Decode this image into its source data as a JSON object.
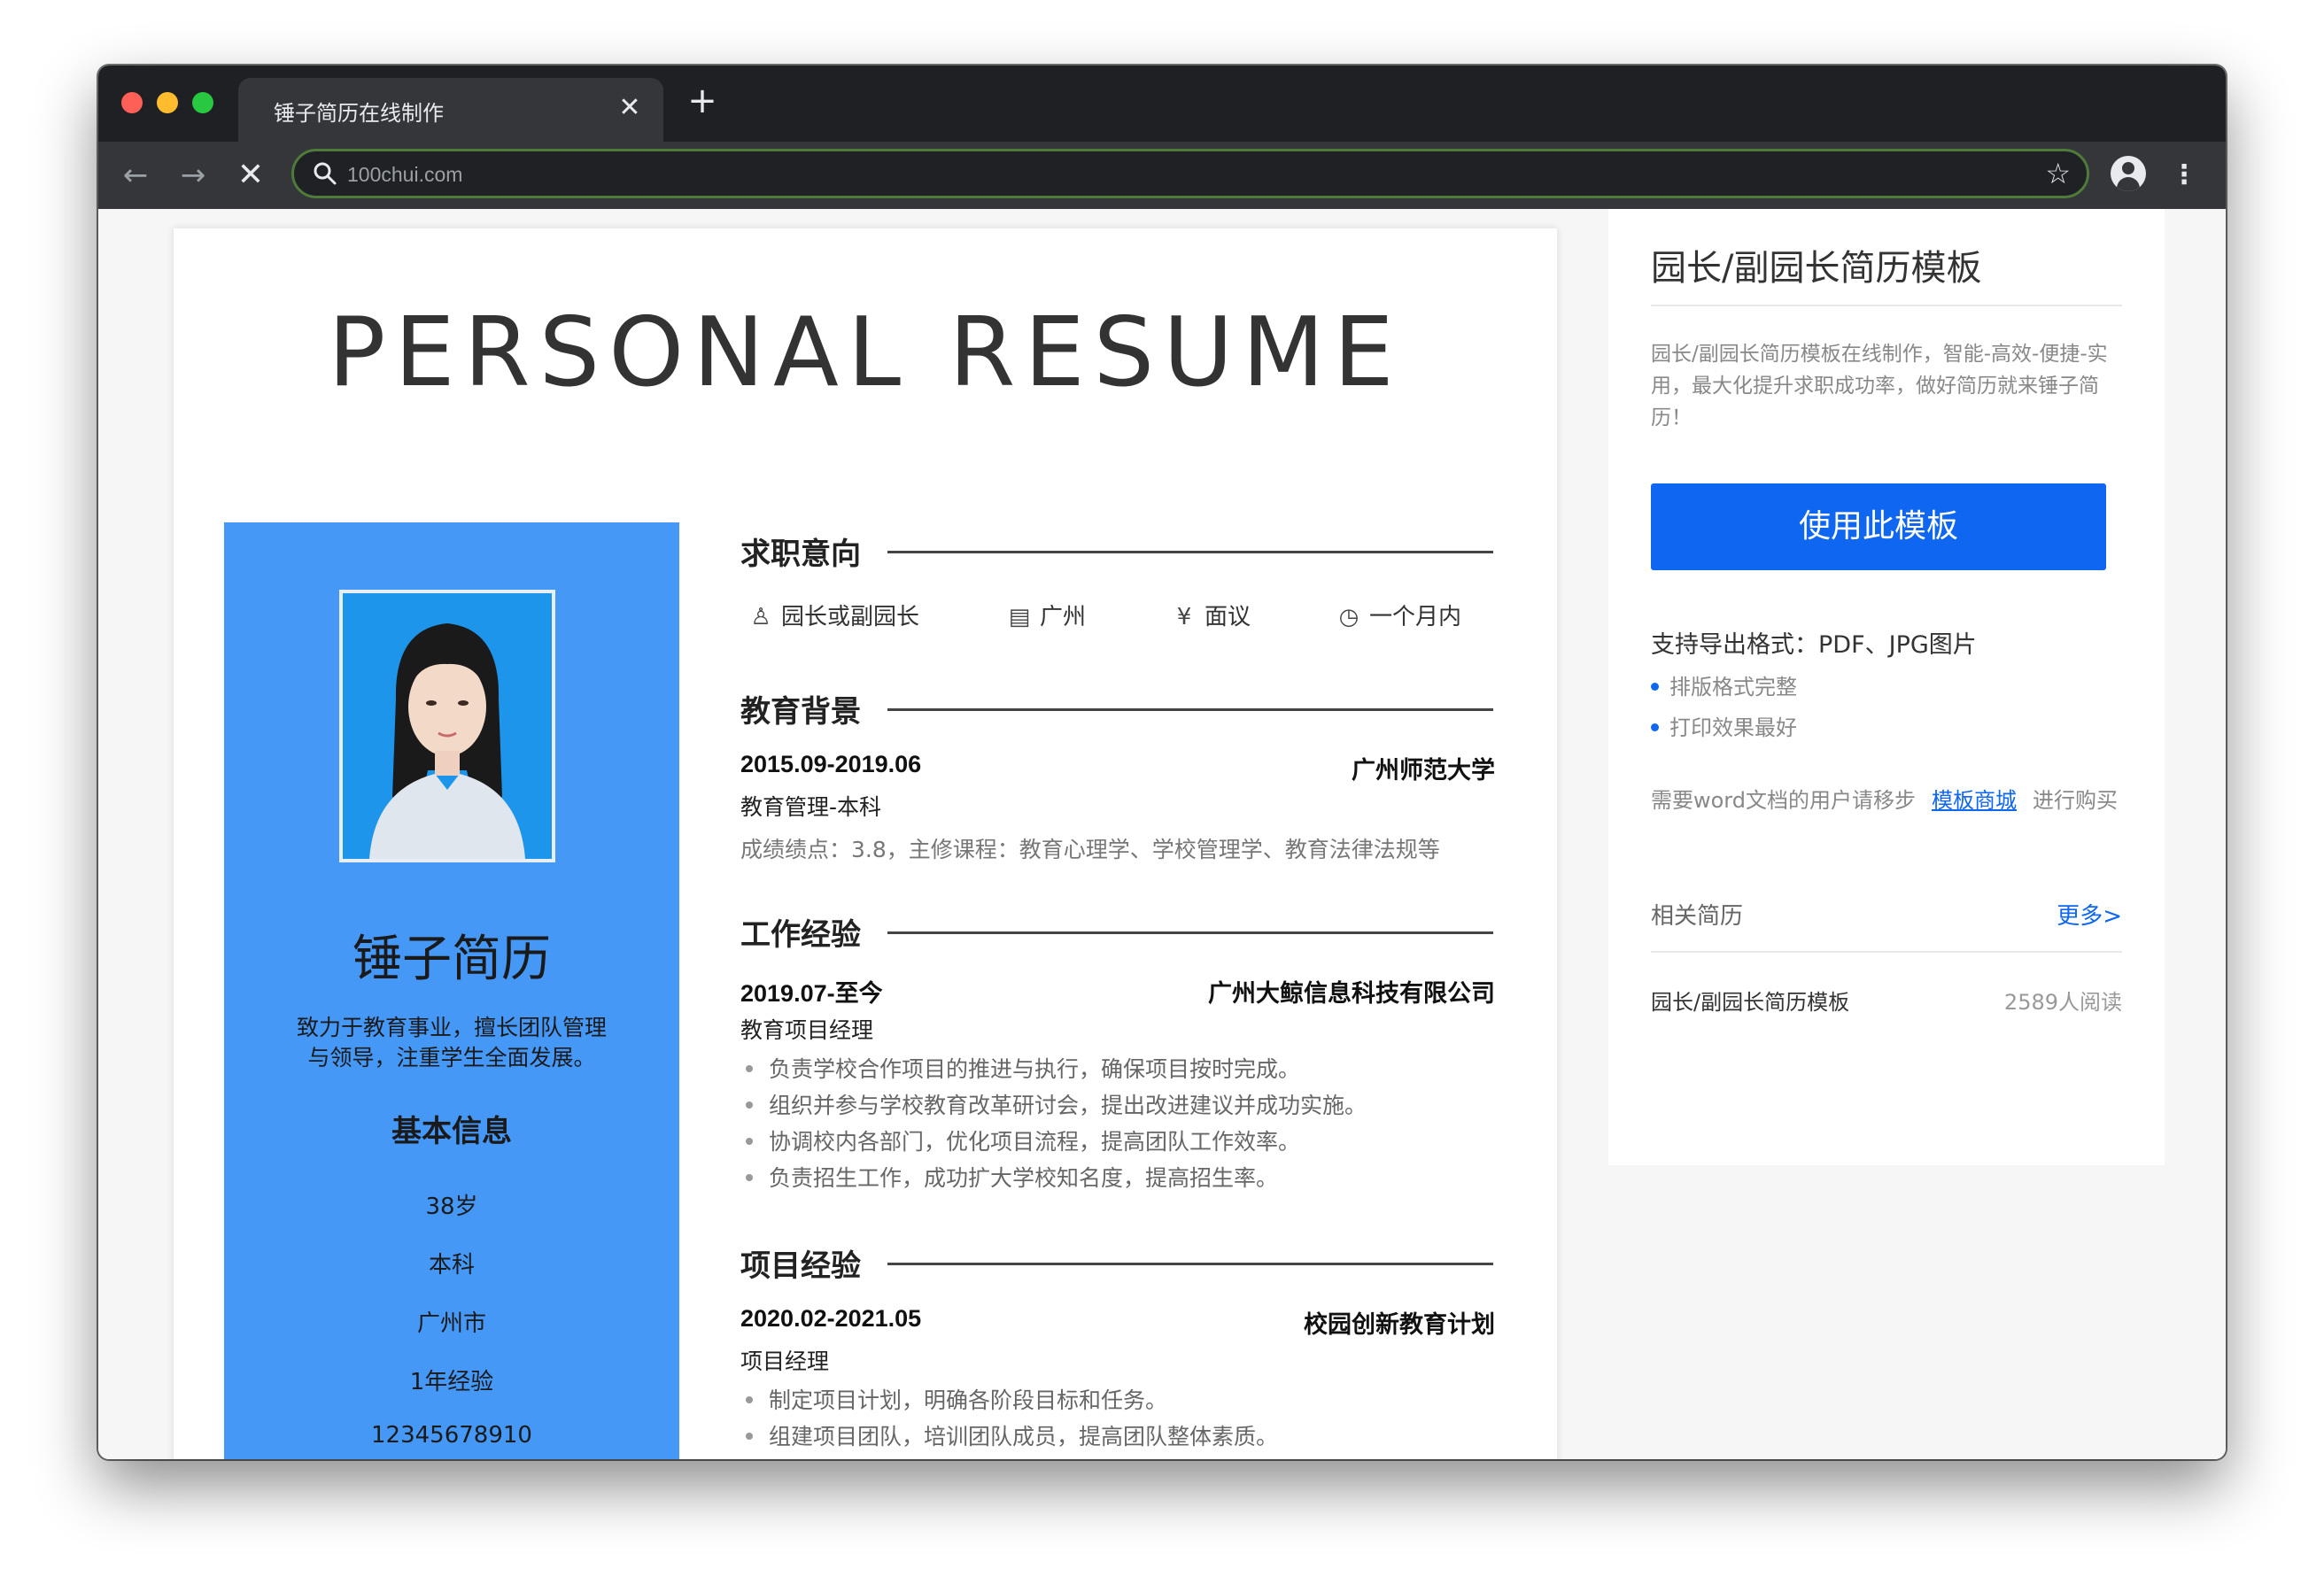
{
  "browser": {
    "tab_title": "锤子简历在线制作",
    "tab_close": "✕",
    "new_tab": "+",
    "url": "100chui.com",
    "back": "←",
    "forward": "→",
    "stop": "✕",
    "star": "☆",
    "menu": "⋮"
  },
  "resume": {
    "title": "PERSONAL RESUME",
    "name": "锤子简历",
    "motto_line1": "致力于教育事业，擅长团队管理",
    "motto_line2": "与领导，注重学生全面发展。",
    "basic_title": "基本信息",
    "basic_info": [
      "38岁",
      "本科",
      "广州市",
      "1年经验",
      "12345678910"
    ],
    "intent": {
      "heading": "求职意向",
      "position": "园长或副园长",
      "city": "广州",
      "salary": "面议",
      "availability": "一个月内",
      "icons": [
        "tie-icon",
        "building-icon",
        "yen-icon",
        "clock-icon"
      ]
    },
    "education": {
      "heading": "教育背景",
      "period": "2015.09-2019.06",
      "school": "广州师范大学",
      "major": "教育管理-本科",
      "details": "成绩绩点：3.8，主修课程：教育心理学、学校管理学、教育法律法规等"
    },
    "work": {
      "heading": "工作经验",
      "period": "2019.07-至今",
      "company": "广州大鲸信息科技有限公司",
      "role": "教育项目经理",
      "bullets": [
        "负责学校合作项目的推进与执行，确保项目按时完成。",
        "组织并参与学校教育改革研讨会，提出改进建议并成功实施。",
        "协调校内各部门，优化项目流程，提高团队工作效率。",
        "负责招生工作，成功扩大学校知名度，提高招生率。"
      ]
    },
    "project": {
      "heading": "项目经验",
      "period": "2020.02-2021.05",
      "name": "校园创新教育计划",
      "role": "项目经理",
      "bullets": [
        "制定项目计划，明确各阶段目标和任务。",
        "组建项目团队，培训团队成员，提高团队整体素质。"
      ]
    }
  },
  "sidebar": {
    "title": "园长/副园长简历模板",
    "description": "园长/副园长简历模板在线制作，智能-高效-便捷-实用，最大化提升求职成功率，做好简历就来锤子简历！",
    "use_button": "使用此模板",
    "export_formats": "支持导出格式：PDF、JPG图片",
    "features": [
      "排版格式完整",
      "打印效果最好"
    ],
    "word_prefix": "需要word文档的用户请移步",
    "word_link": "模板商城",
    "word_suffix": "进行购买",
    "related_label": "相关简历",
    "more_link": "更多>",
    "related_item": "园长/副园长简历模板",
    "related_reads": "2589人阅读"
  },
  "colors": {
    "resume_left": "#4598f6",
    "primary_button": "#0f66f0",
    "tab_bar": "#1f2023",
    "toolbar": "#35363a"
  }
}
